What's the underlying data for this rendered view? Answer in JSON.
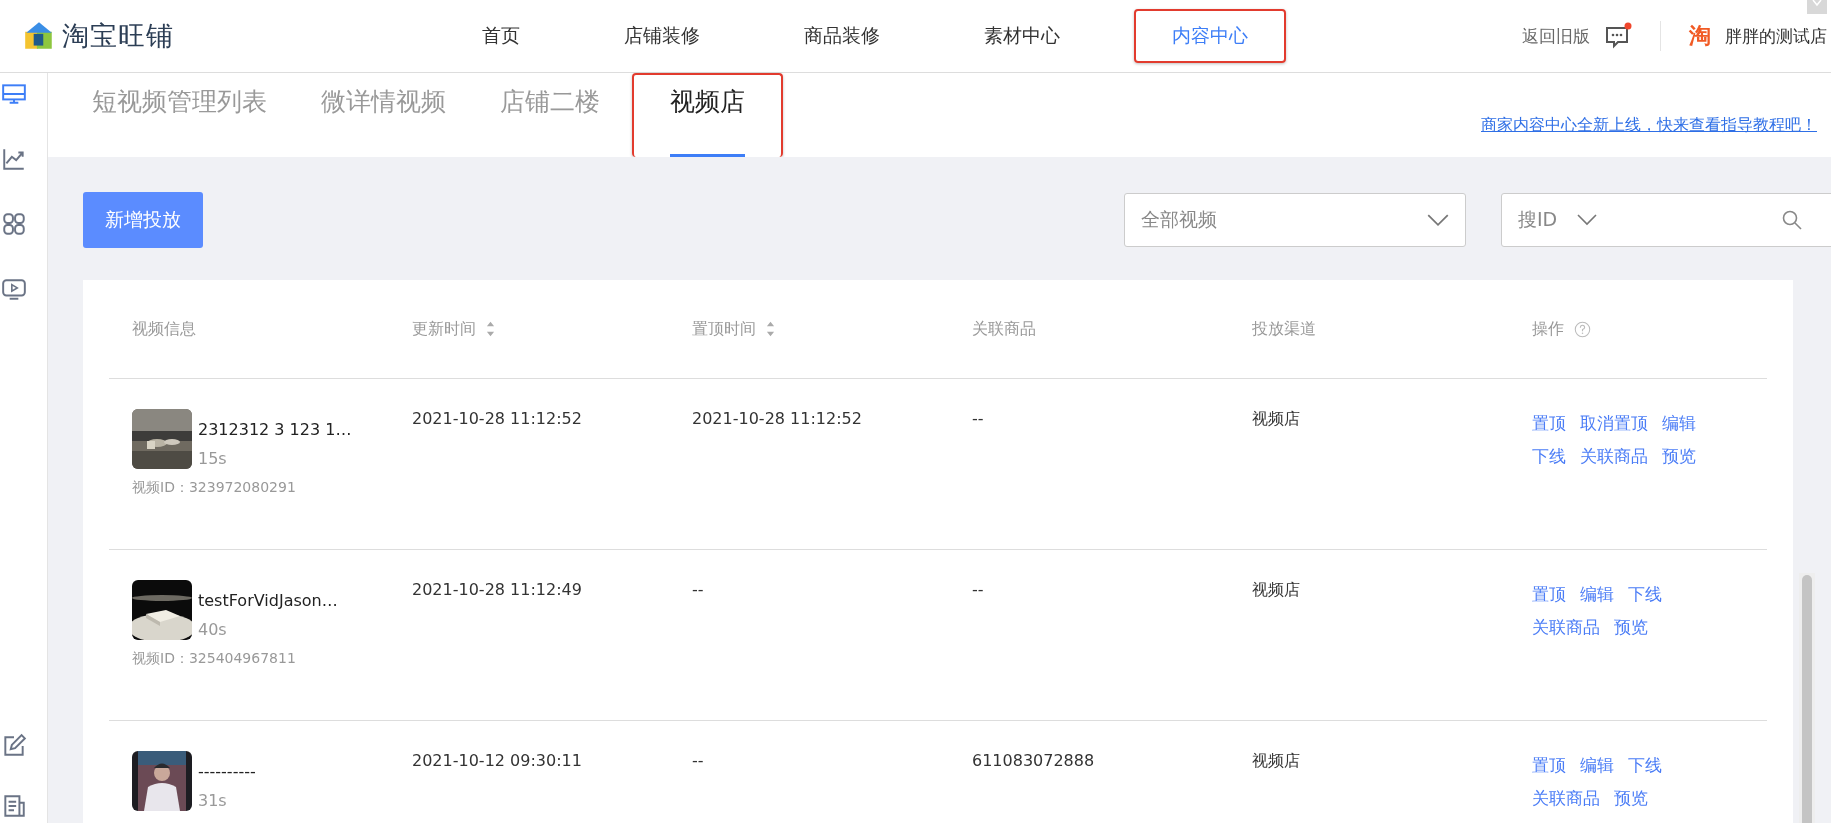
{
  "header": {
    "logo": "淘宝旺铺",
    "nav": [
      {
        "label": "首页",
        "selected": false,
        "highlighted": false
      },
      {
        "label": "店铺装修",
        "selected": false,
        "highlighted": false
      },
      {
        "label": "商品装修",
        "selected": false,
        "highlighted": false
      },
      {
        "label": "素材中心",
        "selected": false,
        "highlighted": false
      },
      {
        "label": "内容中心",
        "selected": true,
        "highlighted": true
      }
    ],
    "back_link": "返回旧版",
    "shop_badge": "淘",
    "shop_name": "胖胖的测试店"
  },
  "tabs": [
    {
      "label": "短视频管理列表",
      "selected": false,
      "highlighted": false
    },
    {
      "label": "微详情视频",
      "selected": false,
      "highlighted": false
    },
    {
      "label": "店铺二楼",
      "selected": false,
      "highlighted": false
    },
    {
      "label": "视频店",
      "selected": true,
      "highlighted": true
    }
  ],
  "notice_link": "商家内容中心全新上线，快来查看指导教程吧！",
  "add_button": "新增投放",
  "filter": {
    "value": "全部视频"
  },
  "search": {
    "type": "搜ID"
  },
  "table": {
    "columns": [
      {
        "label": "视频信息",
        "kind": "plain"
      },
      {
        "label": "更新时间",
        "kind": "sortable"
      },
      {
        "label": "置顶时间",
        "kind": "sortable"
      },
      {
        "label": "关联商品",
        "kind": "plain"
      },
      {
        "label": "投放渠道",
        "kind": "plain"
      },
      {
        "label": "操作",
        "kind": "help"
      }
    ],
    "rows": [
      {
        "title": "2312312 3 123 1…",
        "duration": "15s",
        "video_id": "视频ID：323972080291",
        "thumb": {
          "kind": "picture"
        },
        "updated": "2021-10-28 11:12:52",
        "pinned": "2021-10-28 11:12:52",
        "product": "--",
        "channel": "视频店",
        "actions": [
          [
            "置顶",
            "取消置顶",
            "编辑"
          ],
          [
            "下线",
            "关联商品",
            "预览"
          ]
        ]
      },
      {
        "title": "testForVidJason…",
        "duration": "40s",
        "video_id": "视频ID：325404967811",
        "thumb": {
          "kind": "picture"
        },
        "updated": "2021-10-28 11:12:49",
        "pinned": "--",
        "product": "--",
        "channel": "视频店",
        "actions": [
          [
            "置顶",
            "编辑",
            "下线"
          ],
          [
            "关联商品",
            "预览"
          ]
        ]
      },
      {
        "title": "----------",
        "duration": "31s",
        "thumb": {
          "kind": "picture"
        },
        "updated": "2021-10-12 09:30:11",
        "pinned": "--",
        "product": "611083072888",
        "channel": "视频店",
        "actions": [
          [
            "置顶",
            "编辑",
            "下线"
          ],
          [
            "关联商品",
            "预览"
          ]
        ]
      }
    ]
  }
}
